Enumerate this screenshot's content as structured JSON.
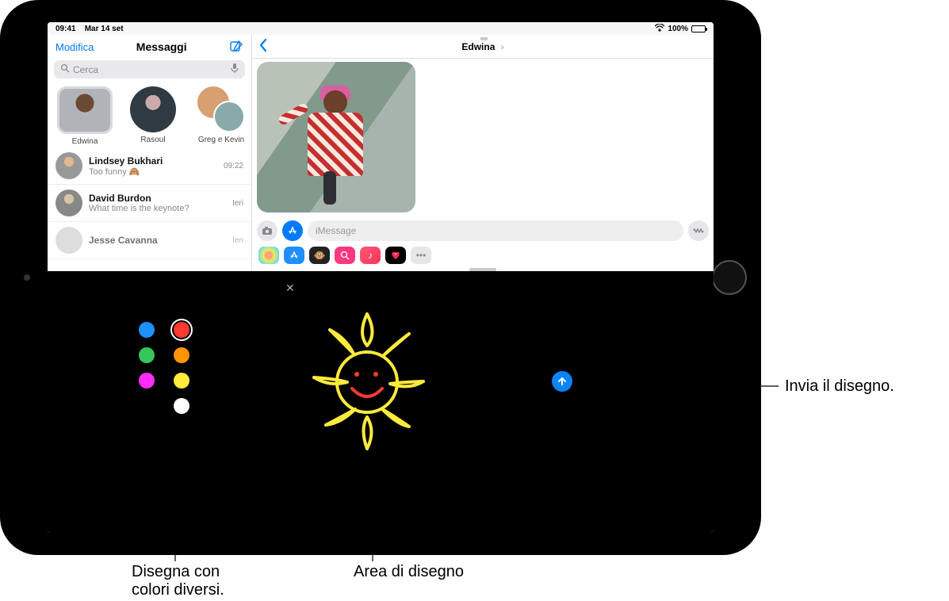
{
  "status": {
    "time": "09:41",
    "date": "Mar 14 set",
    "battery_pct": "100%"
  },
  "sidebar": {
    "edit": "Modifica",
    "title": "Messaggi",
    "search_placeholder": "Cerca",
    "pinned": [
      {
        "name": "Edwina"
      },
      {
        "name": "Rasoul"
      },
      {
        "name": "Greg e Kevin"
      }
    ],
    "conversations": [
      {
        "name": "Lindsey Bukhari",
        "snippet": "Too funny 🙈",
        "time": "09:22"
      },
      {
        "name": "David Burdon",
        "snippet": "What time is the keynote?",
        "time": "Ieri"
      },
      {
        "name": "Jesse Cavanna",
        "snippet": "",
        "time": "Ieri"
      }
    ]
  },
  "conversation": {
    "contact": "Edwina",
    "input_placeholder": "iMessage"
  },
  "digital_touch": {
    "colors": {
      "blue": "#1e90ff",
      "red": "#ff3b30",
      "green": "#34c759",
      "orange": "#ff9500",
      "magenta": "#ff2dff",
      "yellow": "#ffeb3b",
      "white": "#ffffff"
    },
    "selected_color": "red"
  },
  "callouts": {
    "send": "Invia il disegno.",
    "colors": "Disegna con\ncolori diversi.",
    "canvas": "Area di disegno"
  }
}
